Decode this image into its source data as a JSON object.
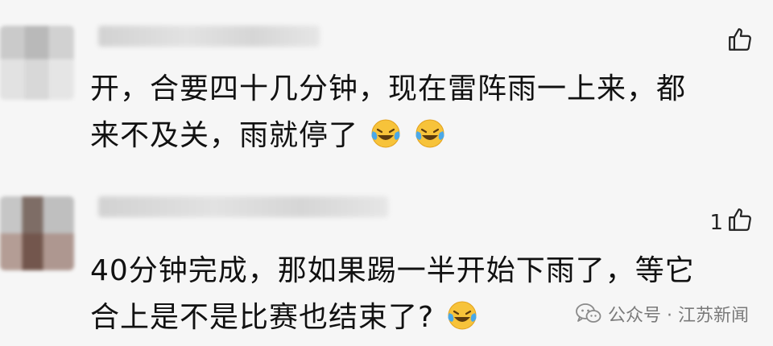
{
  "comments": [
    {
      "likes": "",
      "text_lines": [
        "开，合要四十几分钟，现在雷阵雨一上来，都",
        "来不及关，雨就停了"
      ],
      "trailing_emoji": [
        "laughing-crying-emoji",
        "laughing-crying-emoji"
      ]
    },
    {
      "likes": "1",
      "text_lines": [
        "40分钟完成，那如果踢一半开始下雨了，等它",
        "合上是不是比赛也结束了?"
      ],
      "trailing_emoji": [
        "laughing-crying-emoji"
      ]
    }
  ],
  "watermark": {
    "text": "公众号 · 江苏新闻",
    "icon": "wechat-icon"
  }
}
